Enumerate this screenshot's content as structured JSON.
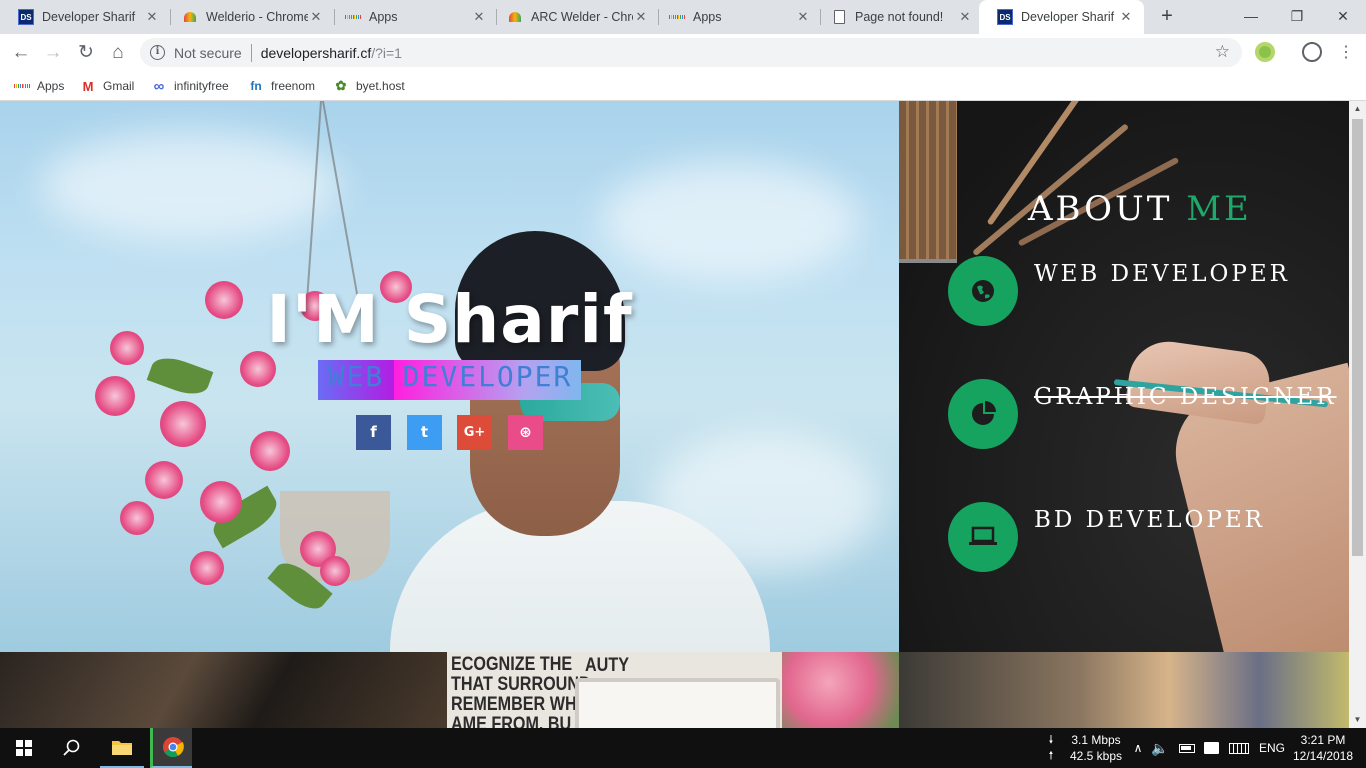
{
  "browser": {
    "tabs": [
      {
        "title": "Developer Sharif",
        "favicon": "ds-logo-icon",
        "active": false
      },
      {
        "title": "Welderio - Chrome",
        "favicon": "arc-welder-icon",
        "active": false
      },
      {
        "title": "Apps",
        "favicon": "apps-grid-icon",
        "active": false
      },
      {
        "title": "ARC Welder - Chrome",
        "favicon": "arc-welder-icon",
        "active": false
      },
      {
        "title": "Apps",
        "favicon": "apps-grid-icon",
        "active": false
      },
      {
        "title": "Page not found!",
        "favicon": "document-icon",
        "active": false
      },
      {
        "title": "Developer Sharif",
        "favicon": "ds-logo-icon",
        "active": true
      }
    ],
    "new_tab": "+",
    "window_controls": {
      "minimize": "—",
      "restore": "❐",
      "close": "✕"
    },
    "address": {
      "security_label": "Not secure",
      "url_host": "developersharif.cf",
      "url_rest": "/?i=1"
    },
    "bookmarks": [
      {
        "label": "Apps",
        "icon": "apps-grid-icon"
      },
      {
        "label": "Gmail",
        "icon": "gmail-icon"
      },
      {
        "label": "infinityfree",
        "icon": "infinity-icon"
      },
      {
        "label": "freenom",
        "icon": "freenom-icon"
      },
      {
        "label": "byet.host",
        "icon": "byethost-icon"
      }
    ]
  },
  "hero": {
    "title": "I'M Sharif",
    "subtitle_part1": "WEB",
    "subtitle_part2": "DEVELOPER",
    "social": [
      {
        "label": "f",
        "name": "facebook",
        "color": "#3b5998"
      },
      {
        "label": "t",
        "name": "twitter",
        "color": "#3d9df2"
      },
      {
        "label": "G+",
        "name": "google-plus",
        "color": "#dd4b39"
      },
      {
        "label": "⊛",
        "name": "dribbble",
        "color": "#ea4c89"
      }
    ]
  },
  "about": {
    "title_part1": "ABOUT",
    "title_part2": "ME",
    "accent_color": "#16a25f",
    "services": [
      {
        "label": "WEB DEVELOPER",
        "icon": "globe-icon"
      },
      {
        "label": "GRAPHIC DESIGNER",
        "icon": "pie-chart-icon"
      },
      {
        "label": "BD DEVELOPER",
        "icon": "laptop-icon"
      }
    ]
  },
  "poster_lines": [
    "ECOGNIZE THE",
    "THAT SURROUND",
    "REMEMBER WHI",
    "AME FROM. BU"
  ],
  "poster_side": "AUTY",
  "taskbar": {
    "download_speed": "3.1 Mbps",
    "upload_speed": "42.5 kbps",
    "language": "ENG",
    "time": "3:21 PM",
    "date": "12/14/2018"
  }
}
